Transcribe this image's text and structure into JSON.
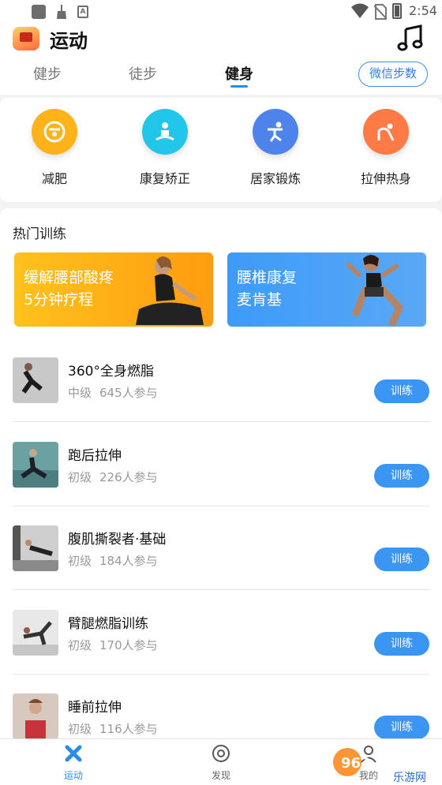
{
  "status_bar": {
    "time": "2:54",
    "a_glyph": "A",
    "icons": [
      "app-square-icon",
      "broom-icon",
      "a-icon",
      "wifi-icon",
      "no-sim-icon",
      "battery-icon"
    ]
  },
  "header": {
    "title": "运动",
    "music_icon": "music-note-icon"
  },
  "tabs": [
    {
      "label": "健步",
      "active": false
    },
    {
      "label": "徒步",
      "active": false
    },
    {
      "label": "健身",
      "active": true
    }
  ],
  "wechat_steps_label": "微信步数",
  "categories": [
    {
      "label": "减肥",
      "icon": "scale-icon",
      "color": "#ffb21a"
    },
    {
      "label": "康复矫正",
      "icon": "meditation-icon",
      "color": "#22c6e8"
    },
    {
      "label": "居家锻炼",
      "icon": "exercise-icon",
      "color": "#4d83ea"
    },
    {
      "label": "拉伸热身",
      "icon": "stretch-icon",
      "color": "#ff7a45"
    }
  ],
  "hot": {
    "title": "热门训练",
    "banners": [
      {
        "line1": "缓解腰部酸疼",
        "line2": "5分钟疗程"
      },
      {
        "line1": "腰椎康复",
        "line2": "麦肯基"
      }
    ],
    "items": [
      {
        "title": "360°全身燃脂",
        "level": "中级",
        "participants": "645人参与",
        "button": "训练"
      },
      {
        "title": "跑后拉伸",
        "level": "初级",
        "participants": "226人参与",
        "button": "训练"
      },
      {
        "title": "腹肌撕裂者·基础",
        "level": "初级",
        "participants": "184人参与",
        "button": "训练"
      },
      {
        "title": "臂腿燃脂训练",
        "level": "初级",
        "participants": "170人参与",
        "button": "训练"
      },
      {
        "title": "睡前拉伸",
        "level": "初级",
        "participants": "116人参与",
        "button": "训练"
      }
    ]
  },
  "bottom_nav": [
    {
      "label": "运动",
      "icon": "run-icon",
      "active": true
    },
    {
      "label": "发现",
      "icon": "compass-icon",
      "active": false
    },
    {
      "label": "我的",
      "icon": "user-icon",
      "active": false
    }
  ],
  "watermark": {
    "brand": "962.NET",
    "sub": "乐游网"
  },
  "colors": {
    "accent": "#2a8bf2",
    "button": "#3b95f2"
  }
}
